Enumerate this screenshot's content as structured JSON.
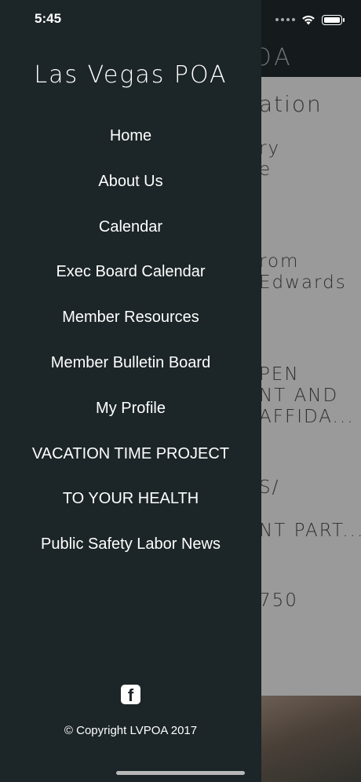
{
  "status_bar": {
    "time": "5:45"
  },
  "background": {
    "header_title": "POA",
    "lines": [
      {
        "text": "ation",
        "big": true
      },
      {
        "text": "ry"
      },
      {
        "text": "e"
      },
      {
        "text": "rom"
      },
      {
        "text": "Edwards"
      },
      {
        "text": "PEN"
      },
      {
        "text": "NT AND"
      },
      {
        "text": "AFFIDA..."
      },
      {
        "text": "S/"
      },
      {
        "text": "NT PART..."
      },
      {
        "text": "750"
      }
    ]
  },
  "drawer": {
    "title": "Las Vegas POA",
    "items": [
      {
        "label": "Home"
      },
      {
        "label": "About Us"
      },
      {
        "label": "Calendar"
      },
      {
        "label": "Exec Board Calendar"
      },
      {
        "label": "Member Resources"
      },
      {
        "label": "Member Bulletin Board"
      },
      {
        "label": "My Profile"
      },
      {
        "label": "VACATION TIME PROJECT"
      },
      {
        "label": "TO YOUR HEALTH"
      },
      {
        "label": "Public Safety Labor News"
      }
    ],
    "social_icon": "facebook-icon",
    "copyright": "© Copyright LVPOA 2017"
  },
  "colors": {
    "drawer_bg": "#1c2528",
    "header_bg": "#151b1d",
    "overlay_bg": "#9a9a9a"
  }
}
